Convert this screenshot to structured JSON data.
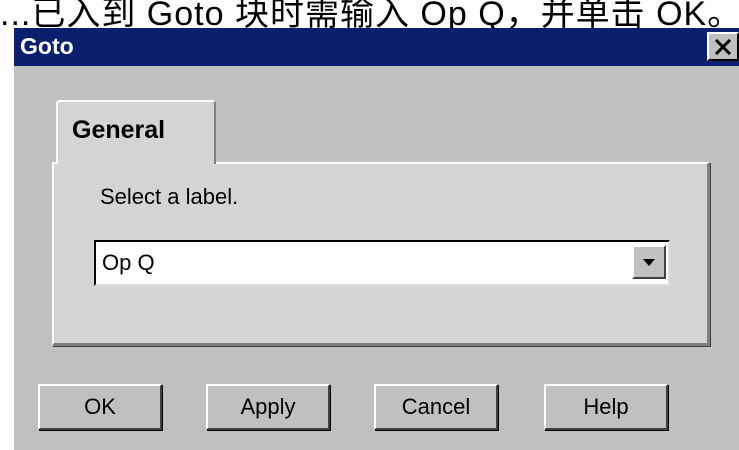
{
  "background": {
    "partial_text": "...已入到 Goto 块时需输入 Op Q，并单击 OK。"
  },
  "window": {
    "title": "Goto",
    "close_icon": "close-x-icon",
    "title_bar_color": "#0a1f6e",
    "face_color": "#c0c0c0"
  },
  "tabs": [
    {
      "label": "General",
      "selected": true
    }
  ],
  "panel": {
    "prompt": "Select a label.",
    "label_select": {
      "value": "Op Q",
      "arrow_icon": "chevron-down-icon"
    }
  },
  "buttons": {
    "ok": "OK",
    "apply": "Apply",
    "cancel": "Cancel",
    "help": "Help"
  }
}
